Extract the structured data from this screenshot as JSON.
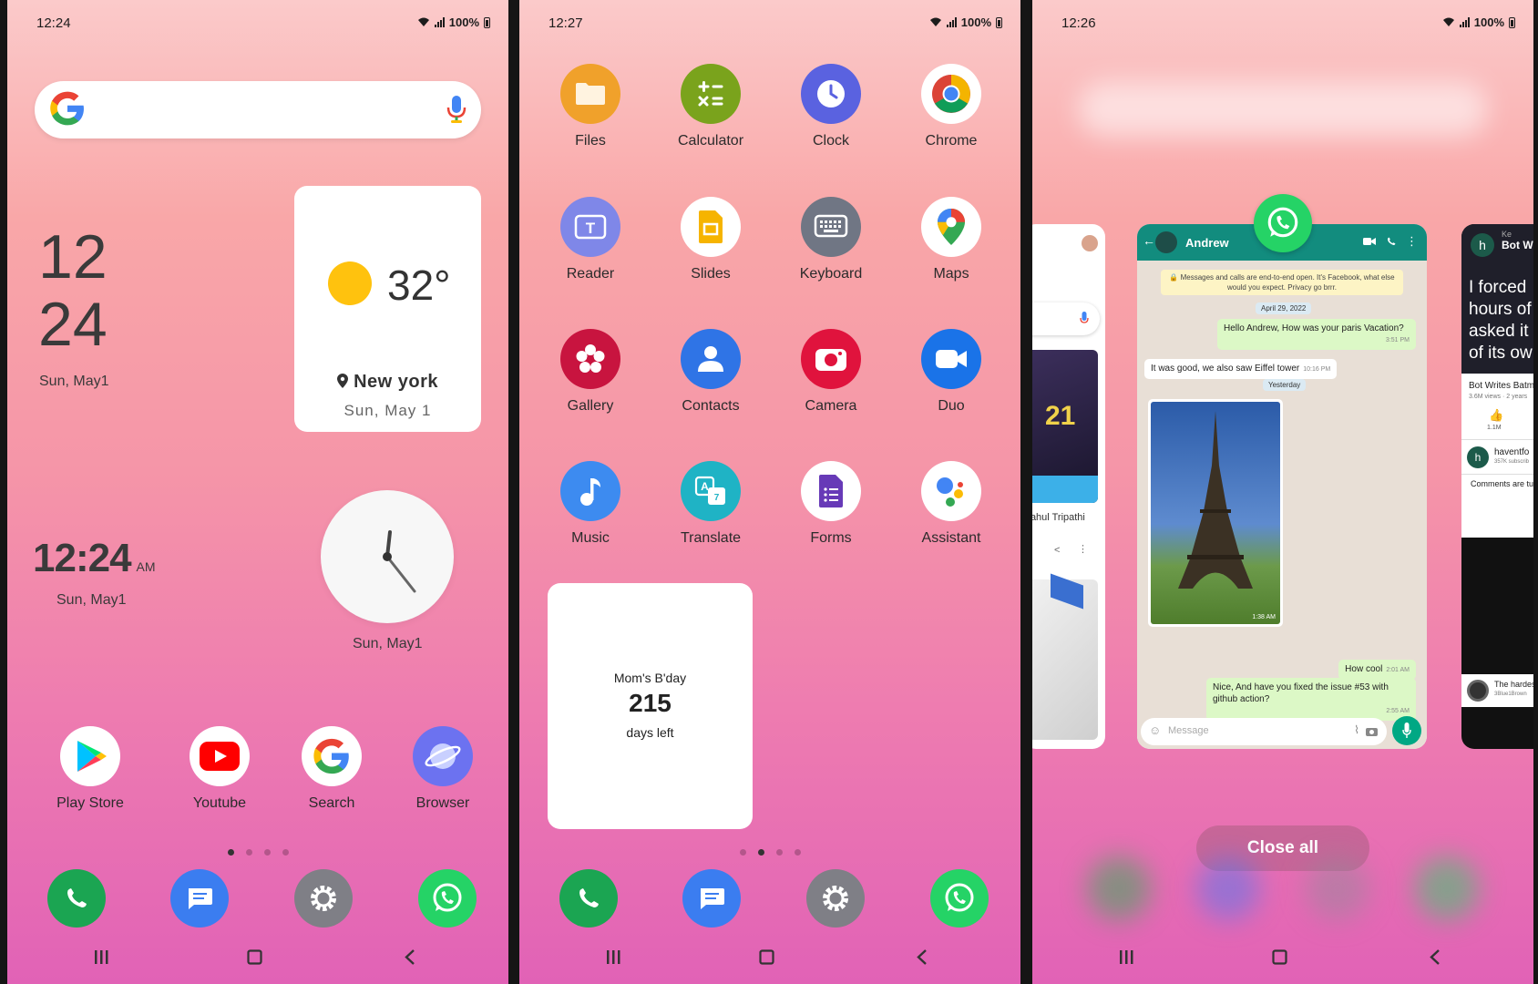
{
  "screens": [
    {
      "status": {
        "time": "12:24",
        "battery": "100%"
      },
      "clock_big": {
        "hour": "12",
        "minute": "24",
        "date": "Sun, May1"
      },
      "weather": {
        "temp": "32°",
        "location": "New york",
        "date": "Sun, May 1"
      },
      "digital_clock": {
        "time": "12:24",
        "ampm": "AM",
        "date": "Sun, May1"
      },
      "analog_clock": {
        "date": "Sun, May1"
      },
      "apps": [
        "Play Store",
        "Youtube",
        "Search",
        "Browser"
      ]
    },
    {
      "status": {
        "time": "12:27",
        "battery": "100%"
      },
      "apps": [
        "Files",
        "Calculator",
        "Clock",
        "Chrome",
        "Reader",
        "Slides",
        "Keyboard",
        "Maps",
        "Gallery",
        "Contacts",
        "Camera",
        "Duo",
        "Music",
        "Translate",
        "Forms",
        "Assistant"
      ],
      "countdown": {
        "title": "Mom's B'day",
        "days": "215",
        "suffix": "days left"
      }
    },
    {
      "status": {
        "time": "12:26",
        "battery": "100%"
      },
      "chat": {
        "contact": "Andrew",
        "notice": "🔒 Messages and calls are end-to-end open. It's Facebook, what else would you expect. Privacy go brrr.",
        "date1": "April 29, 2022",
        "msg1": "Hello Andrew, How was your paris Vacation?",
        "msg1_time": "3:51 PM",
        "msg2": "It was good, we also saw Eiffel tower",
        "msg2_time": "10:16 PM",
        "date2": "Yesterday",
        "photo_time": "1:38 AM",
        "msg3": "How cool",
        "msg3_time": "2:01 AM",
        "msg4": "Nice, And have you fixed the issue #53 with github action?",
        "msg4_time": "2:55 AM",
        "input_placeholder": "Message"
      },
      "left_card": {
        "caption": "Rahul Tripathi",
        "jersey": "21"
      },
      "right_card": {
        "header": "Bot W",
        "header_sub": "Ke",
        "big_text": [
          "I forced",
          "hours of",
          "asked it",
          "of its ow"
        ],
        "title": "Bot Writes Batm",
        "meta": "3.6M views · 2 years",
        "likes": "1.1M",
        "channel": "haventfo",
        "channel_sub": "357K subscrib",
        "comments": "Comments are tu",
        "next_title": "The hardes",
        "next_sub": "3Blue1Brown"
      },
      "close_all": "Close all"
    }
  ],
  "colors": {
    "whatsapp_green": "#25d366",
    "whatsapp_header": "#128c7e",
    "sun": "#ffc20e"
  }
}
